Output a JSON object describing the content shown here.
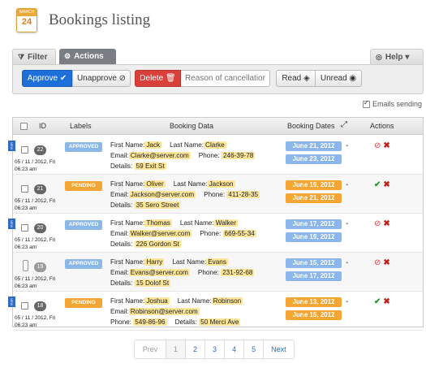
{
  "header": {
    "title": "Bookings listing",
    "calendar_month": "MARCH",
    "calendar_day": "24"
  },
  "tabs": {
    "filter": "Filter",
    "actions": "Actions",
    "help": "Help"
  },
  "toolbar": {
    "approve": "Approve ✔",
    "unapprove": "Unapprove ⊘",
    "delete": "Delete 🗑",
    "reason_placeholder": "Reason of cancellation he",
    "read": "Read ◈",
    "unread": "Unread ◉"
  },
  "emails_sending": "Emails sending",
  "columns": {
    "id": "ID",
    "labels": "Labels",
    "booking_data": "Booking Data",
    "booking_dates": "Booking Dates",
    "actions": "Actions"
  },
  "rows": [
    {
      "id": "22",
      "created": "05 / 11 / 2012, Fri",
      "created_time": "06:23 am",
      "label": "APPROVED",
      "first_name": "Jack",
      "last_name": "Clarke",
      "email": "Clarke@server.com",
      "phone": "246-39-78",
      "details": "59 Exit St",
      "date_from": "June 21, 2012",
      "date_to": "June 23, 2012",
      "new": true
    },
    {
      "id": "21",
      "created": "05 / 11 / 2012, Fri",
      "created_time": "06:23 am",
      "label": "PENDING",
      "first_name": "Oliver",
      "last_name": "Jackson",
      "email": "Jackson@server.com",
      "phone": "411-28-35",
      "details": "35 Sero Street",
      "date_from": "June 19, 2012",
      "date_to": "June 21, 2012",
      "new": false
    },
    {
      "id": "20",
      "created": "05 / 11 / 2012, Fri",
      "created_time": "06:23 am",
      "label": "APPROVED",
      "first_name": "Thomas",
      "last_name": "Walker",
      "email": "Walker@server.com",
      "phone": "669-55-34",
      "details": "226 Gordon St",
      "date_from": "June 17, 2012",
      "date_to": "June 19, 2012",
      "new": true
    },
    {
      "id": "19",
      "created": "05 / 11 / 2012, Fri",
      "created_time": "06:23 am",
      "label": "APPROVED",
      "first_name": "Harry",
      "last_name": "Evans",
      "email": "Evans@server.com",
      "phone": "231-92-68",
      "details": "15 Dolof St",
      "date_from": "June 15, 2012",
      "date_to": "June 17, 2012",
      "new": false
    },
    {
      "id": "18",
      "created": "05 / 11 / 2012, Fri",
      "created_time": "06:23 am",
      "label": "PENDING",
      "first_name": "Joshua",
      "last_name": "Robinson",
      "email": "Robinson@server.com",
      "phone": "549-86-96",
      "details": "50 Merci Ave",
      "date_from": "June 13, 2012",
      "date_to": "June 15, 2012",
      "new": true
    }
  ],
  "field_labels": {
    "first": "First Name:",
    "last": "Last Name:",
    "email": "Email:",
    "phone": "Phone:",
    "details": "Details:"
  },
  "pagination": {
    "prev": "Prev",
    "pages": [
      "1",
      "2",
      "3",
      "4",
      "5"
    ],
    "next": "Next"
  },
  "new_flag": "NEW",
  "colors": {
    "approved": "#8cb8e8",
    "pending": "#f4a534",
    "primary": "#1e6fd9",
    "danger": "#d9403a"
  }
}
